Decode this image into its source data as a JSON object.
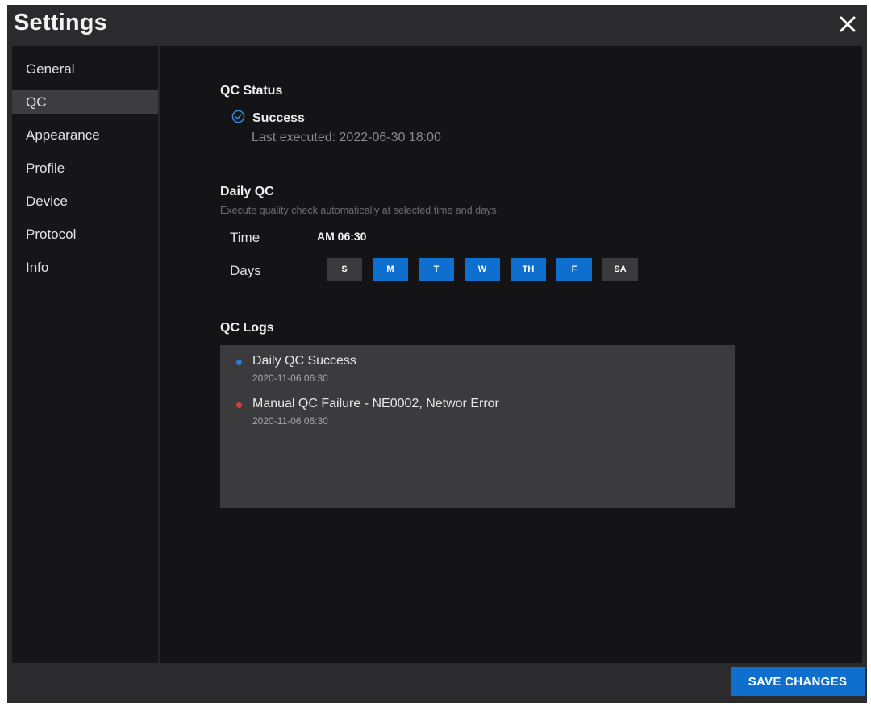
{
  "window": {
    "title": "Settings"
  },
  "sidebar": {
    "items": [
      {
        "label": "General"
      },
      {
        "label": "QC"
      },
      {
        "label": "Appearance"
      },
      {
        "label": "Profile"
      },
      {
        "label": "Device"
      },
      {
        "label": "Protocol"
      },
      {
        "label": "Info"
      }
    ],
    "active": "QC"
  },
  "qc_status": {
    "heading": "QC Status",
    "status": "Success",
    "status_icon": "check-circle-icon",
    "last_executed": "Last executed: 2022-06-30 18:00"
  },
  "daily_qc": {
    "heading": "Daily QC",
    "hint": "Execute quality check automatically at selected time and days.",
    "time_label": "Time",
    "time_value": "AM 06:30",
    "days_label": "Days",
    "days": [
      {
        "label": "S",
        "selected": false
      },
      {
        "label": "M",
        "selected": true
      },
      {
        "label": "T",
        "selected": true
      },
      {
        "label": "W",
        "selected": true
      },
      {
        "label": "TH",
        "selected": true
      },
      {
        "label": "F",
        "selected": true
      },
      {
        "label": "SA",
        "selected": false
      }
    ]
  },
  "qc_logs": {
    "heading": "QC Logs",
    "entries": [
      {
        "message": "Daily QC Success",
        "timestamp": "2020-11-06 06:30",
        "status": "success"
      },
      {
        "message": "Manual QC Failure - NE0002, Networ Error",
        "timestamp": "2020-11-06 06:30",
        "status": "failure"
      }
    ]
  },
  "footer": {
    "save_label": "SAVE CHANGES"
  },
  "colors": {
    "accent": "#0f6fcf",
    "success_dot": "#1f7fe0",
    "failure_dot": "#e0393c",
    "check_icon": "#2f8fe8"
  }
}
